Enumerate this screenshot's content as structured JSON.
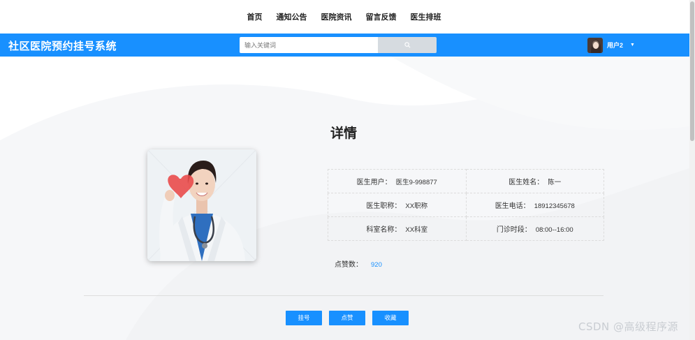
{
  "top_nav": {
    "items": [
      {
        "label": "首页",
        "name": "nav-home"
      },
      {
        "label": "通知公告",
        "name": "nav-notice"
      },
      {
        "label": "医院资讯",
        "name": "nav-news"
      },
      {
        "label": "留言反馈",
        "name": "nav-feedback"
      },
      {
        "label": "医生排班",
        "name": "nav-schedule"
      }
    ]
  },
  "header": {
    "site_title": "社区医院预约挂号系统",
    "search_placeholder": "输入关键词",
    "search_icon": "search-icon",
    "username": "用户2",
    "caret_icon": "caret-down-icon"
  },
  "detail": {
    "title": "详情",
    "fields": [
      [
        {
          "label": "医生用户：",
          "value": "医生9-998877"
        },
        {
          "label": "医生姓名：",
          "value": "陈一"
        }
      ],
      [
        {
          "label": "医生职称：",
          "value": "XX职称"
        },
        {
          "label": "医生电话：",
          "value": "18912345678"
        }
      ],
      [
        {
          "label": "科室名称：",
          "value": "XX科室"
        },
        {
          "label": "门诊时段：",
          "value": "08:00--16:00"
        }
      ]
    ],
    "likes_label": "点赞数：",
    "likes_count": "920"
  },
  "actions": {
    "register_label": "挂号",
    "like_label": "点赞",
    "favorite_label": "收藏"
  },
  "watermark": "CSDN @高级程序源",
  "colors": {
    "primary": "#1890ff",
    "search_button": "#d6dbe0"
  }
}
